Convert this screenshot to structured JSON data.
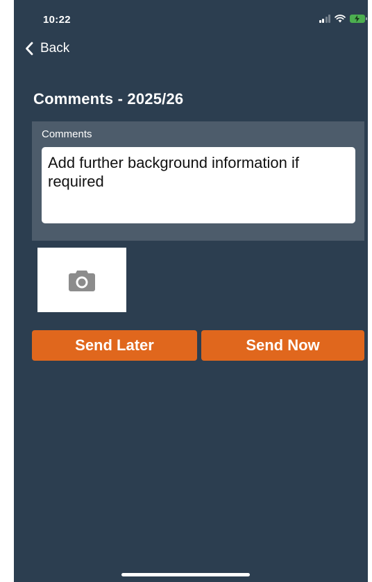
{
  "status_bar": {
    "time": "10:22",
    "icons": [
      "cellular-signal-icon",
      "wifi-icon",
      "battery-charging-icon"
    ]
  },
  "nav": {
    "back_label": "Back",
    "back_icon": "chevron-left-icon"
  },
  "page": {
    "title": "Comments - 2025/26"
  },
  "comments": {
    "label": "Comments",
    "placeholder": "Add further background information if required",
    "value": ""
  },
  "photo": {
    "icon": "camera-icon"
  },
  "actions": {
    "send_later_label": "Send Later",
    "send_now_label": "Send Now"
  },
  "colors": {
    "background": "#2c3e50",
    "panel": "#4d5c6b",
    "accent": "#e0671d",
    "text": "#ffffff"
  }
}
